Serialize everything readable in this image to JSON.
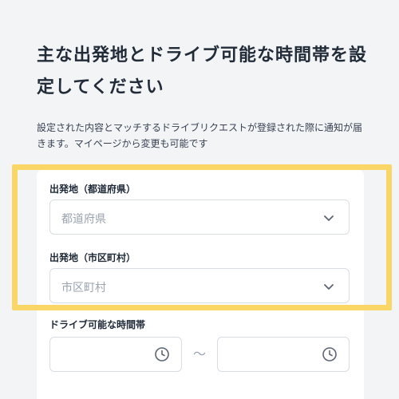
{
  "heading": "主な出発地とドライブ可能な時間帯を設定してください",
  "description": "設定された内容とマッチするドライブリクエストが登録された際に通知が届きます。マイページから変更も可能です",
  "prefecture": {
    "label": "出発地（都道府県）",
    "placeholder": "都道府県"
  },
  "city": {
    "label": "出発地（市区町村）",
    "placeholder": "市区町村"
  },
  "time_range": {
    "label": "ドライブ可能な時間帯",
    "separator": "〜"
  },
  "colors": {
    "highlight": "#f9d665",
    "background": "#f3f4f6",
    "placeholder": "#9aa3b0"
  },
  "icons": [
    "chevron-down-icon",
    "clock-icon"
  ]
}
